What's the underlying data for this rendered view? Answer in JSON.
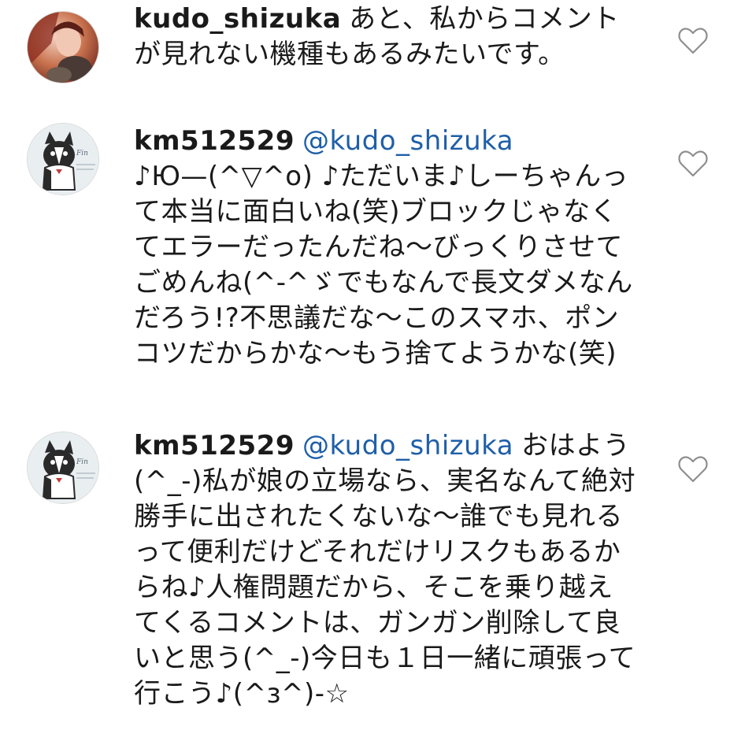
{
  "comments": [
    {
      "username": "kudo_shizuka",
      "mention": "",
      "text": "あと、私からコメントが見れない機種もあるみたいです。",
      "avatar": "profile-photo-woman",
      "liked": false
    },
    {
      "username": "km512529",
      "mention": "@kudo_shizuka",
      "text": "♪Ю—(^▽^o) ♪ただいま♪しーちゃんって本当に面白いね(笑)ブロックじゃなくてエラーだったんだね〜びっくりさせてごめんね(^-^ゞでもなんで長文ダメなんだろう!?不思議だな〜このスマホ、ポンコツだからかな〜もう捨てようかな(笑)",
      "avatar": "french-bulldog-logo",
      "liked": false
    },
    {
      "username": "km512529",
      "mention": "@kudo_shizuka",
      "text": "おはよう(^_-)私が娘の立場なら、実名なんて絶対勝手に出されたくないな〜誰でも見れるって便利だけどそれだけリスクもあるからね♪人権問題だから、そこを乗り越えてくるコメントは、ガンガン削除して良いと思う(^_-)今日も１日一緒に頑張って行こう♪(^з^)-☆",
      "avatar": "french-bulldog-logo",
      "liked": false
    }
  ],
  "colors": {
    "username": "#1a1a1a",
    "mention": "#1f5fa8",
    "heart_outline": "#8e8e8e"
  },
  "icons": {
    "like": "heart-outline-icon"
  }
}
